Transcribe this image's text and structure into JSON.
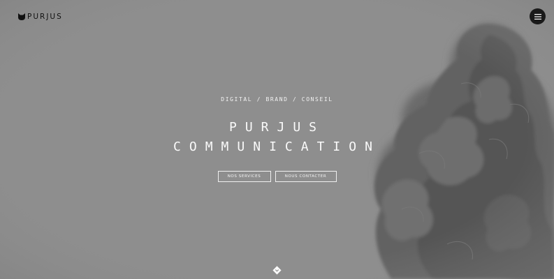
{
  "brand": {
    "name": "PURJUS",
    "logo_icon": "cat-head-icon"
  },
  "menu": {
    "icon": "hamburger-icon"
  },
  "hero": {
    "tagline": "DIGITAL / BRAND / CONSEIL",
    "title_line1": "PURJUS",
    "title_line2": "COMMUNICATION",
    "buttons": {
      "services": "NOS SERVICES",
      "contact": "NOUS CONTACTER"
    },
    "scroll_icon": "chevron-down-diamond-icon"
  },
  "colors": {
    "background": "#8d8d8d",
    "smoke": "#5c5c5c",
    "text": "#fafafa",
    "menu_button": "#1a1a1a"
  }
}
